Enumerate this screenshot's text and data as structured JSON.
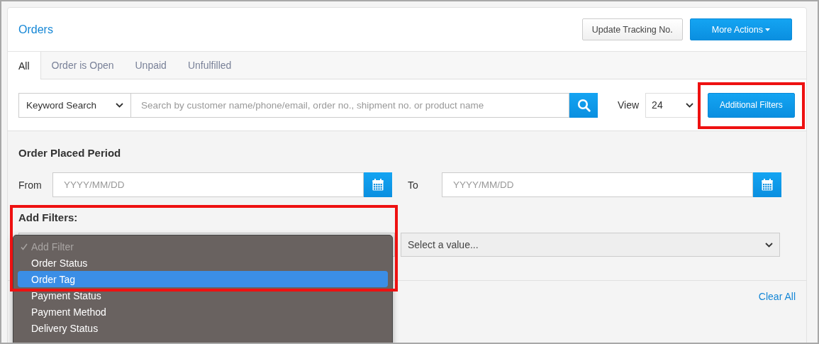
{
  "title": "Orders",
  "header_buttons": [
    {
      "label": "Update Tracking No.",
      "kind": "default"
    },
    {
      "label": "More Actions",
      "kind": "primary",
      "caret": true
    }
  ],
  "tabs": [
    {
      "label": "All",
      "selected": true
    },
    {
      "label": "Order is Open",
      "selected": false
    },
    {
      "label": "Unpaid",
      "selected": false
    },
    {
      "label": "Unfulfilled",
      "selected": false
    }
  ],
  "search": {
    "type_select": "Keyword Search",
    "placeholder": "Search by customer name/phone/email, order no., shipment no. or product name",
    "view_label": "View",
    "view_value": "24",
    "filters_button": "Additional Filters",
    "highlighted": true
  },
  "period": {
    "title": "Order Placed Period",
    "from_label": "From",
    "from_placeholder": "YYYY/MM/DD",
    "to_label": "To",
    "to_placeholder": "YYYY/MM/DD"
  },
  "add_filters": {
    "title": "Add Filters:",
    "highlighted": true,
    "value_select": "Select a value...",
    "menu": [
      {
        "label": "Add Filter",
        "checked": true,
        "disabled": true,
        "selected": false
      },
      {
        "label": "Order Status",
        "checked": false,
        "disabled": false,
        "selected": false
      },
      {
        "label": "Order Tag",
        "checked": false,
        "disabled": false,
        "selected": true
      },
      {
        "label": "Payment Status",
        "checked": false,
        "disabled": false,
        "selected": false
      },
      {
        "label": "Payment Method",
        "checked": false,
        "disabled": false,
        "selected": false
      },
      {
        "label": "Delivery Status",
        "checked": false,
        "disabled": false,
        "selected": false
      }
    ]
  },
  "clear_all": "Clear All"
}
